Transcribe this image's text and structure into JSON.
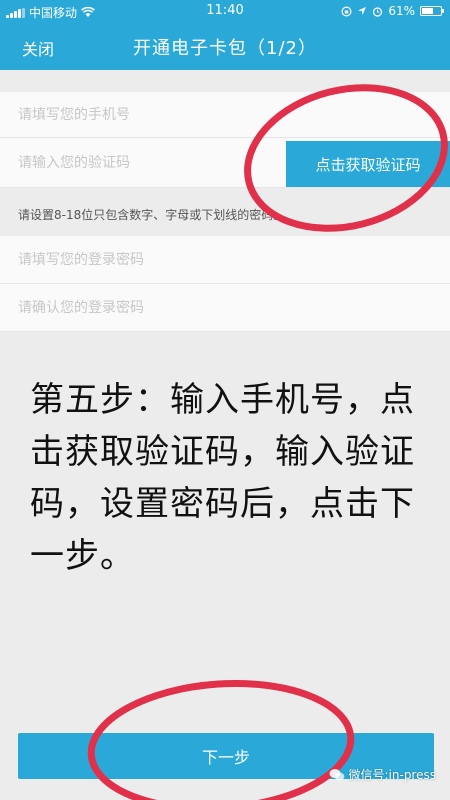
{
  "status_bar": {
    "carrier": "中国移动",
    "time": "11:40",
    "battery": "61%",
    "battery_level": 0.61
  },
  "nav": {
    "close_label": "关闭",
    "title": "开通电子卡包（1/2）"
  },
  "form": {
    "phone_placeholder": "请填写您的手机号",
    "code_placeholder": "请输入您的验证码",
    "get_code_label": "点击获取验证码",
    "password_hint": "请设置8-18位只包含数字、字母或下划线的密码。",
    "password_placeholder": "请填写您的登录密码",
    "confirm_placeholder": "请确认您的登录密码"
  },
  "caption": "第五步：输入手机号，点击获取验证码，输入验证码，设置密码后，点击下一步。",
  "next_label": "下一步",
  "watermark": "微信号:in-press",
  "colors": {
    "accent": "#2aa9d8",
    "highlight_circle": "#e0304a"
  }
}
